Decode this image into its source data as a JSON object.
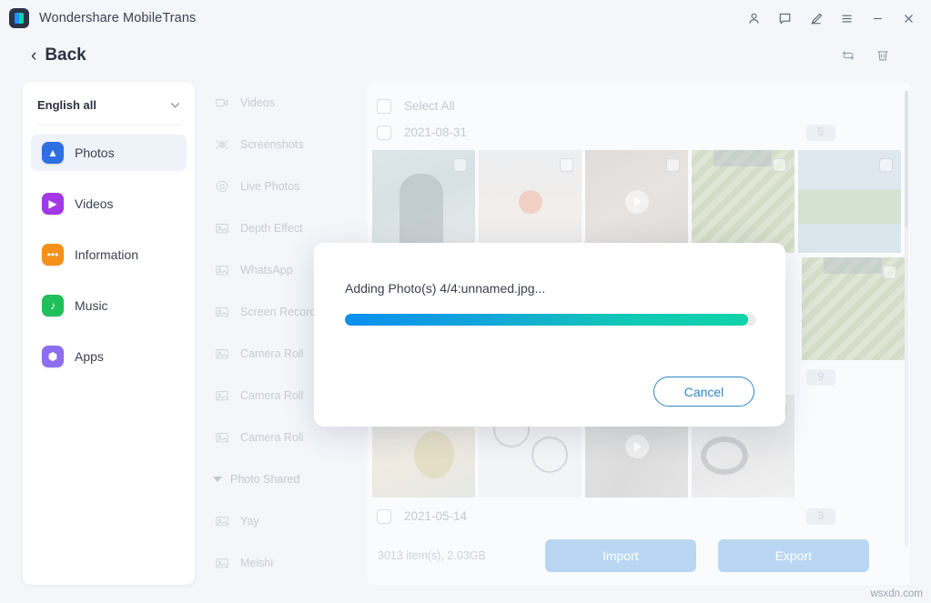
{
  "window": {
    "app_title": "Wondershare MobileTrans",
    "logo_icon": "mobiletrans-logo-icon",
    "controls": [
      {
        "name": "account-icon",
        "label": "Account"
      },
      {
        "name": "feedback-icon",
        "label": "Feedback"
      },
      {
        "name": "edit-pen-icon",
        "label": "Edit"
      },
      {
        "name": "menu-icon",
        "label": "Menu"
      },
      {
        "name": "minimize-icon",
        "label": "Minimize"
      },
      {
        "name": "close-icon",
        "label": "Close"
      }
    ]
  },
  "header": {
    "back_label": "Back",
    "back_chevron": "‹",
    "tools": [
      {
        "name": "refresh-icon",
        "label": "Refresh"
      },
      {
        "name": "delete-icon",
        "label": "Delete"
      }
    ]
  },
  "sidebar": {
    "language_selector": {
      "value": "English all",
      "chevron": "∨"
    },
    "items": [
      {
        "label": "Photos",
        "icon": "photos-icon",
        "color": "#2f6fe4",
        "glyph": "▲",
        "active": true
      },
      {
        "label": "Videos",
        "icon": "videos-icon",
        "color": "#a238e8",
        "glyph": "▶",
        "active": false
      },
      {
        "label": "Information",
        "icon": "information-icon",
        "color": "#f59019",
        "glyph": "•••",
        "active": false
      },
      {
        "label": "Music",
        "icon": "music-icon",
        "color": "#1fbf5a",
        "glyph": "♪",
        "active": false
      },
      {
        "label": "Apps",
        "icon": "apps-icon",
        "color": "#8d6df0",
        "glyph": "⬢",
        "active": false
      }
    ]
  },
  "categories": {
    "items": [
      {
        "label": "Videos",
        "icon": "video-camera-icon",
        "type": "item"
      },
      {
        "label": "Screenshots",
        "icon": "screenshot-icon",
        "type": "item"
      },
      {
        "label": "Live Photos",
        "icon": "live-photo-icon",
        "type": "item"
      },
      {
        "label": "Depth Effect",
        "icon": "album-icon",
        "type": "item"
      },
      {
        "label": "WhatsApp",
        "icon": "album-icon",
        "type": "item"
      },
      {
        "label": "Screen Recorder",
        "icon": "album-icon",
        "type": "item"
      },
      {
        "label": "Camera Roll",
        "icon": "album-icon",
        "type": "item"
      },
      {
        "label": "Camera Roll",
        "icon": "album-icon",
        "type": "item"
      },
      {
        "label": "Camera Roll",
        "icon": "album-icon",
        "type": "item"
      },
      {
        "label": "Photo Shared",
        "icon": "triangle-down-icon",
        "type": "group"
      },
      {
        "label": "Yay",
        "icon": "album-icon",
        "type": "item"
      },
      {
        "label": "Meishi",
        "icon": "album-icon",
        "type": "item"
      }
    ]
  },
  "content": {
    "select_all_label": "Select All",
    "groups": [
      {
        "date": "2021-08-31",
        "badge": "5"
      },
      {
        "date": "2021-05-14",
        "badge": "9"
      },
      {
        "date": "2021-05-14",
        "badge": "3"
      }
    ],
    "thumbs_row1": [
      {
        "name": "photo-person",
        "style": "im-person",
        "video": false
      },
      {
        "name": "photo-flowers",
        "style": "im-flowers",
        "video": false
      },
      {
        "name": "video-clip-1",
        "style": "im-video",
        "video": true
      },
      {
        "name": "photo-leaves",
        "style": "im-leaves",
        "video": false
      },
      {
        "name": "photo-palm",
        "style": "im-palm",
        "video": false
      }
    ],
    "thumbs_row2": [
      {
        "name": "photo-leaves-2",
        "style": "im-leaves",
        "video": false
      }
    ],
    "thumbs_row3": [
      {
        "name": "photo-artwork",
        "style": "im-art",
        "video": false
      },
      {
        "name": "photo-infograph",
        "style": "im-info",
        "video": false
      },
      {
        "name": "video-clip-2",
        "style": "im-video2",
        "video": true
      },
      {
        "name": "photo-cable",
        "style": "im-cable",
        "video": false
      }
    ]
  },
  "bottom": {
    "count_label": "3013 item(s), 2.03GB",
    "import_label": "Import",
    "export_label": "Export"
  },
  "dialog": {
    "message": "Adding Photo(s) 4/4:unnamed.jpg...",
    "progress_percent": 98,
    "cancel_label": "Cancel",
    "bar_start_color": "#0b8ff0",
    "bar_end_color": "#0fd3a9"
  },
  "watermark": "wsxdn.com"
}
